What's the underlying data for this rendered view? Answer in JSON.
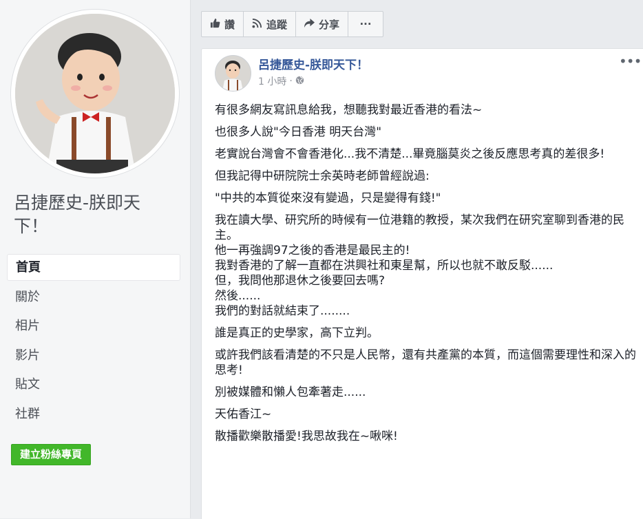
{
  "page": {
    "name": "呂捷歷史-朕即天下！"
  },
  "sidebar": {
    "items": [
      {
        "label": "首頁",
        "active": true
      },
      {
        "label": "關於"
      },
      {
        "label": "相片"
      },
      {
        "label": "影片"
      },
      {
        "label": "貼文"
      },
      {
        "label": "社群"
      }
    ],
    "create_button": "建立粉絲專頁"
  },
  "toolbar": {
    "like_label": "讚",
    "follow_label": "追蹤",
    "share_label": "分享",
    "more_label": "···",
    "like_icon": "thumbs-up-icon",
    "follow_icon": "rss-icon",
    "share_icon": "share-arrow-icon"
  },
  "post": {
    "author": "呂捷歷史-朕即天下！",
    "time": "1 小時",
    "separator": "·",
    "privacy_icon": "globe-icon",
    "more": "•••",
    "paragraphs": [
      "有很多網友寫訊息給我，想聽我對最近香港的看法~",
      "也很多人說\"今日香港 明天台灣\"",
      "老實說台灣會不會香港化...我不清楚...畢竟腦莫炎之後反應思考真的差很多!",
      "但我記得中研院院士余英時老師曾經說過:",
      "\"中共的本質從來沒有變過，只是變得有錢!\"",
      "我在讀大學、研究所的時候有一位港籍的教授，某次我們在研究室聊到香港的民主。\n他一再強調97之後的香港是最民主的!\n我對香港的了解一直都在洪興社和東星幫，所以也就不敢反駁......\n但，我問他那退休之後要回去嗎?\n然後......\n我們的對話就結束了........",
      "誰是真正的史學家，高下立判。",
      "或許我們該看清楚的不只是人民幣，還有共產黨的本質，而這個需要理性和深入的思考!",
      "別被媒體和懶人包牽著走......",
      "天佑香江~",
      "散播歡樂散播愛!我思故我在~啾咪!"
    ]
  },
  "colors": {
    "link": "#365899",
    "create_button": "#42b72a",
    "background": "#e9ebee"
  }
}
